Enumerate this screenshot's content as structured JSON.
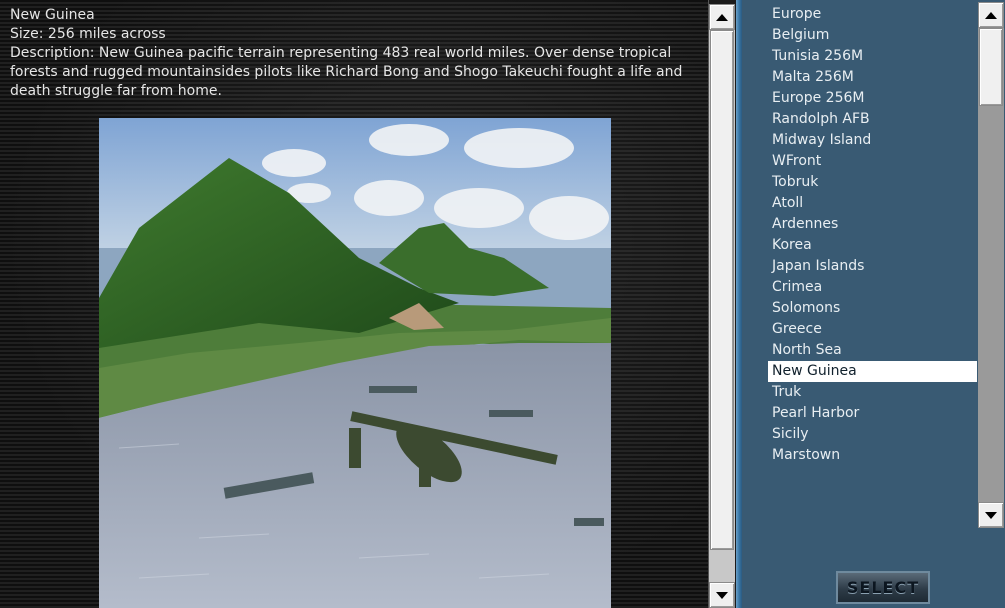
{
  "map_info": {
    "title": "New Guinea",
    "size": "Size: 256 miles across",
    "description": "Description: New Guinea pacific terrain representing 483 real world miles. Over dense tropical forests and rugged mountainsides pilots like Richard Bong and Shogo Takeuchi fought a life and death struggle far from home."
  },
  "map_list": {
    "items": [
      {
        "label": "Europe"
      },
      {
        "label": "Belgium"
      },
      {
        "label": "Tunisia 256M"
      },
      {
        "label": "Malta 256M"
      },
      {
        "label": "Europe 256M"
      },
      {
        "label": "Randolph AFB"
      },
      {
        "label": "Midway Island"
      },
      {
        "label": "WFront"
      },
      {
        "label": "Tobruk"
      },
      {
        "label": "Atoll"
      },
      {
        "label": "Ardennes"
      },
      {
        "label": "Korea"
      },
      {
        "label": "Japan Islands"
      },
      {
        "label": "Crimea"
      },
      {
        "label": "Solomons"
      },
      {
        "label": "Greece"
      },
      {
        "label": "North Sea"
      },
      {
        "label": "New Guinea",
        "selected": true
      },
      {
        "label": "Truk"
      },
      {
        "label": "Pearl Harbor"
      },
      {
        "label": "Sicily"
      },
      {
        "label": "Marstown"
      }
    ],
    "selected_label": "New Guinea"
  },
  "select_button": {
    "label": "SELECT"
  },
  "colors": {
    "list_background": "#395a73",
    "selection_background": "#ffffff",
    "divider_accent": "#3a78a8"
  },
  "icons": {
    "scroll_up": "triangle-up-icon",
    "scroll_down": "triangle-down-icon"
  }
}
